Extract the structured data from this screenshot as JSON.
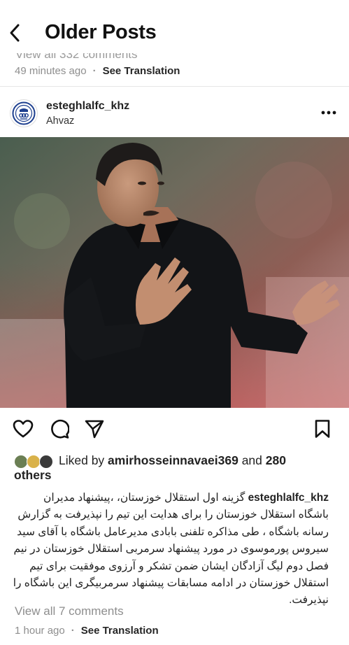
{
  "header": {
    "title": "Older Posts"
  },
  "previous_post": {
    "comments_cut": "View all 332 comments",
    "time": "49 minutes ago",
    "separator": "·",
    "translate": "See Translation"
  },
  "post": {
    "username": "esteghlalfc_khz",
    "location": "Ahvaz",
    "likes": {
      "prefix": "Liked by ",
      "user": "amirhosseinnavaei369",
      "middle": " and ",
      "count": "280",
      "suffix": "others"
    },
    "caption": {
      "user": "esteghlalfc_khz",
      "text": "گزینه اول استقلال خوزستان، ،پیشنهاد مدیران باشگاه استقلال خوزستان را برای هدایت این تیم را نپذیرفت به گزارش رسانه باشگاه ، طی مذاکره تلفنی  بابادی مدیرعامل باشگاه با آقای سید سیروس پورموسوی در مورد پیشنهاد سرمربی استقلال خوزستان در نیم  فصل دوم لیگ آزادگان ایشان ضمن تشکر و آرزوی موفقیت برای تیم استقلال خوزستان در ادامه مسابقات پیشنهاد سرمربیگری این باشگاه را نپذیرفت."
    },
    "view_comments": "View all 7 comments",
    "time": "1 hour ago",
    "separator": "·",
    "translate": "See Translation"
  },
  "icons": {
    "back": "chevron-left-icon",
    "more": "more-horizontal-icon",
    "like": "heart-outline-icon",
    "comment": "comment-icon",
    "share": "paper-plane-icon",
    "save": "bookmark-icon"
  },
  "colors": {
    "text": "#111111",
    "muted": "#8e8e8e",
    "divider": "#e6e6e6",
    "club_blue": "#1d3f8f"
  }
}
